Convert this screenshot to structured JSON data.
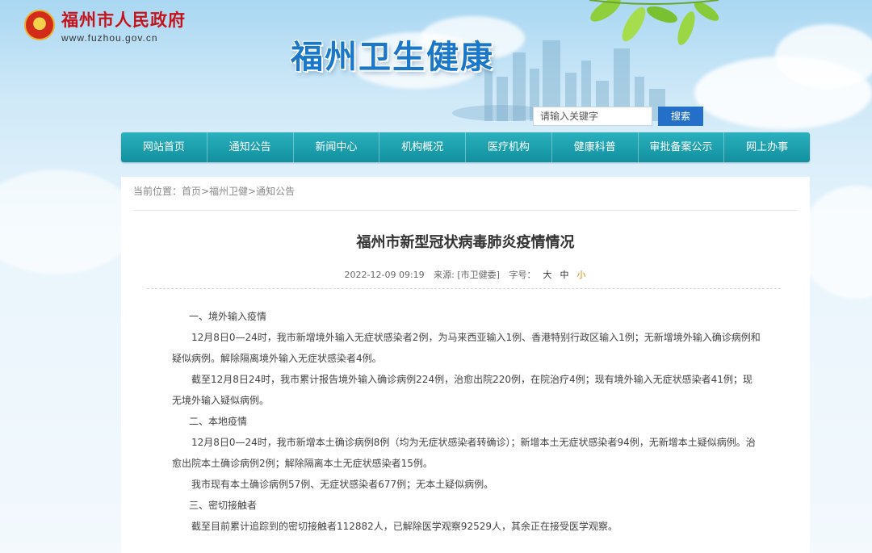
{
  "header": {
    "gov_name": "福州市人民政府",
    "gov_url": "www.fuzhou.gov.cn",
    "site_title": "福州卫生健康"
  },
  "search": {
    "placeholder": "请输入关键字",
    "button_label": "搜索"
  },
  "nav": {
    "items": [
      "网站首页",
      "通知公告",
      "新闻中心",
      "机构概况",
      "医疗机构",
      "健康科普",
      "审批备案公示",
      "网上办事"
    ]
  },
  "breadcrumb": "当前位置：首页>福州卫健>通知公告",
  "article": {
    "title": "福州市新型冠状病毒肺炎疫情情况",
    "date": "2022-12-09 09:19",
    "source": "来源: [市卫健委]",
    "font_size_label": "字号：",
    "size_large": "大",
    "size_medium": "中",
    "size_small": "小",
    "paragraphs": [
      "一、境外输入疫情",
      "12月8日0—24时，我市新增境外输入无症状感染者2例，为马来西亚输入1例、香港特别行政区输入1例；无新增境外输入确诊病例和疑似病例。解除隔离境外输入无症状感染者4例。",
      "截至12月8日24时，我市累计报告境外输入确诊病例224例，治愈出院220例，在院治疗4例；现有境外输入无症状感染者41例；现无境外输入疑似病例。",
      "二、本地疫情",
      "12月8日0—24时，我市新增本土确诊病例8例（均为无症状感染者转确诊）；新增本土无症状感染者94例，无新增本土疑似病例。治愈出院本土确诊病例2例；解除隔离本土无症状感染者15例。",
      "我市现有本土确诊病例57例、无症状感染者677例；无本土疑似病例。",
      "三、密切接触者",
      "截至目前累计追踪到的密切接触者112882人，已解除医学观察92529人，其余正在接受医学观察。"
    ]
  },
  "colors": {
    "nav_bg": "#1aa0ae",
    "search_button": "#2470c9",
    "site_title": "#1b78c8",
    "gov_name": "#c4131b"
  }
}
